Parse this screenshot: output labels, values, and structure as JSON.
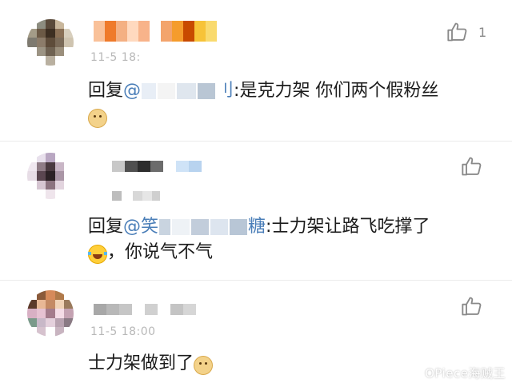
{
  "comments": [
    {
      "time": "11-5 18:",
      "reply_prefix": "回复",
      "mention_start": "@",
      "mention_end": "刂",
      "text": ":是克力架 你们两个假粉丝",
      "emoji": "doge-emoji",
      "likes": "1",
      "name_colors": [
        "#f9c199",
        "#ef7a2a",
        "#f4b083",
        "#ffd9bf",
        "#f8b38a",
        "#ffffff",
        "#f3a46c",
        "#f59c2c",
        "#c84a00",
        "#f7c338",
        "#f9da6e"
      ],
      "avatar_colors": [
        "#ffffff",
        "#8d8d80",
        "#5a4a3a",
        "#c9b79c",
        "#ffffff",
        "#a49c88",
        "#6c5a46",
        "#3d2f22",
        "#8a7056",
        "#d8cfbd",
        "#7e7a70",
        "#8c7c6a",
        "#5e4c3a",
        "#7a6a58",
        "#cfc4b0",
        "#ffffff",
        "#9c9484",
        "#6f6252",
        "#9b8f7c",
        "#ffffff",
        "#ffffff",
        "#ffffff",
        "#b9b0a0",
        "#ffffff",
        "#ffffff"
      ]
    },
    {
      "reply_prefix": "回复",
      "mention_start": "@笑",
      "mention_end": "糖",
      "text": ":士力架让路飞吃撑了",
      "text_line2": "，你说气不气",
      "emoji": "laugh-cry-emoji",
      "name_colors": [
        "#c8c8c8",
        "#505050",
        "#2d2d2d",
        "#6c6c6c",
        "#ffffff",
        "#cfe3f7",
        "#b8d3ef"
      ],
      "avatar_colors": [
        "#ffffff",
        "#e8e0ec",
        "#b9a7c2",
        "#ffffff",
        "#ffffff",
        "#efe7ef",
        "#8f7c86",
        "#4a3a40",
        "#c9b6c6",
        "#ffffff",
        "#e7dde6",
        "#5a4650",
        "#2c2226",
        "#aa96a6",
        "#ffffff",
        "#ffffff",
        "#d6c6d2",
        "#8c7480",
        "#e2d4de",
        "#ffffff",
        "#ffffff",
        "#ffffff",
        "#efe5ec",
        "#ffffff",
        "#ffffff"
      ]
    },
    {
      "time": "11-5 18:00",
      "text": "士力架做到了",
      "emoji": "doge-emoji",
      "name_colors": [
        "#a8a8a8",
        "#b8b8b8",
        "#c6c6c6",
        "#ffffff",
        "#d0d0d0",
        "#ffffff",
        "#c4c4c4",
        "#d6d6d6"
      ],
      "avatar_colors": [
        "#ffffff",
        "#8a5a3a",
        "#d68a5a",
        "#b07a4a",
        "#ffffff",
        "#5c3a2a",
        "#e8b896",
        "#c48a64",
        "#f0d2b6",
        "#9a7a5c",
        "#d8b0c4",
        "#e6c2d2",
        "#a47c8c",
        "#f4dce6",
        "#c4a2b2",
        "#7a9a8a",
        "#c8b8c8",
        "#e4d0dc",
        "#b8a2b0",
        "#8a7a84",
        "#ffffff",
        "#d6c2ce",
        "#ffffff",
        "#c8b4c0",
        "#ffffff"
      ]
    }
  ],
  "watermark": "OPiece海贼王",
  "colors": {
    "mention": "#4a7eb8",
    "text": "#1c1c1c",
    "meta": "#b8b8b8",
    "divider": "#ececec",
    "icon": "#8a8a8a"
  }
}
